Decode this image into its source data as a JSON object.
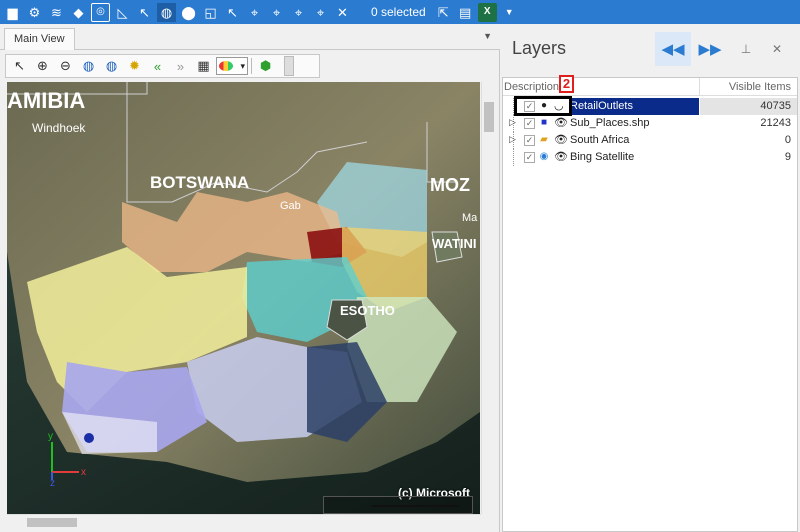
{
  "toolbar": {
    "icons": [
      "folder-icon",
      "settings-icon",
      "layers-icon",
      "map-icon",
      "frame-icon",
      "measure-icon",
      "pointer-path-icon",
      "globe-icon",
      "pin-icon",
      "note-icon",
      "select-arrow-icon",
      "select-node-icon",
      "select-vertex-icon",
      "select-multi-icon",
      "select-line-icon",
      "clear-select-icon",
      "export-icon",
      "table-icon",
      "excel-icon",
      "dropdown-icon"
    ],
    "selected_text": "0 selected",
    "excel_label": "X"
  },
  "tabs": [
    {
      "label": "Main View"
    }
  ],
  "map_toolbar": {
    "tools": [
      "pointer-icon",
      "zoom-in-icon",
      "zoom-out-icon",
      "globe-full-icon",
      "globe-region-icon",
      "settings-gear-icon",
      "back-icon",
      "forward-icon",
      "grid-icon",
      "palette-combo",
      "bookmark-icon"
    ]
  },
  "map": {
    "labels": {
      "namibia": "AMIBIA",
      "windhoek": "Windhoek",
      "botswana": "BOTSWANA",
      "mozambique": "MOZ",
      "gaborone": "Gab",
      "maputo": "Ma",
      "swaziland": "WATINI",
      "lesotho": "ESOTHO"
    },
    "copyright": "(c) Microsoft",
    "axis_x": "x",
    "axis_y": "y",
    "axis_z": "z"
  },
  "layers": {
    "title": "Layers",
    "columns": {
      "description": "Description",
      "visible_items": "Visible Items"
    },
    "step_badge": "2",
    "rows": [
      {
        "name": "RetailOutlets",
        "count": "40735",
        "symbol": "point",
        "selected": true
      },
      {
        "name": "Sub_Places.shp",
        "count": "21243",
        "symbol": "polygon"
      },
      {
        "name": "South Africa",
        "count": "0",
        "symbol": "folder"
      },
      {
        "name": "Bing Satellite",
        "count": "9",
        "symbol": "imagery"
      }
    ]
  },
  "colors": {
    "toolbar_bg": "#2b7bd0",
    "selection_bg": "#0a2b8a",
    "badge_red": "#e01e1e"
  }
}
